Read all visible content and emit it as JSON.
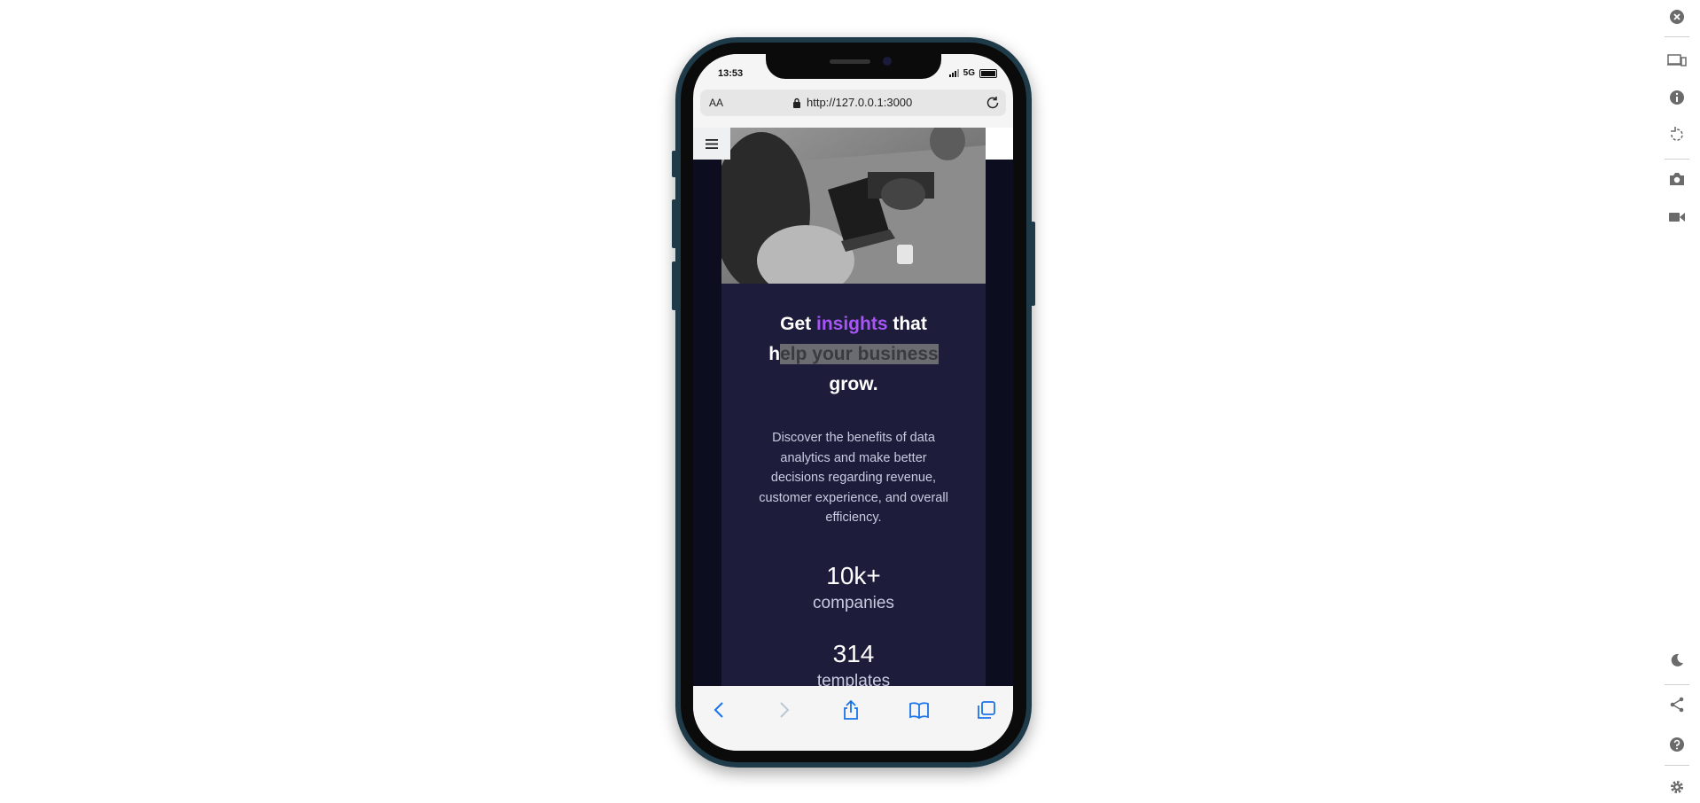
{
  "status_bar": {
    "time": "13:53",
    "network": "5G"
  },
  "browser": {
    "text_size_label": "AA",
    "url": "http://127.0.0.1:3000"
  },
  "page": {
    "menu_icon": "hamburger-menu-icon",
    "hero_image_alt": "woman-working-on-laptop",
    "headline": {
      "part1": "Get ",
      "accent": "insights",
      "part2": " that",
      "part3_plain": "h",
      "part3_highlight": "elp your business",
      "part4": "grow."
    },
    "description": "Discover the benefits of data analytics and make better decisions regarding revenue, customer experience, and overall efficiency.",
    "stats": [
      {
        "value": "10k+",
        "label": "companies"
      },
      {
        "value": "314",
        "label": "templates"
      }
    ],
    "colors": {
      "accent": "#a855f7",
      "card_bg": "#1d1c3a",
      "page_bg": "#0c0e1f"
    }
  },
  "browser_nav": {
    "icons": [
      "back-icon",
      "forward-icon",
      "share-icon",
      "bookmarks-icon",
      "tabs-icon"
    ]
  },
  "devtools_toolbar": {
    "icons": [
      "close-icon",
      "devices-icon",
      "info-icon",
      "rotate-icon",
      "screenshot-icon",
      "video-icon",
      "dark-mode-icon",
      "share-icon",
      "help-icon",
      "settings-icon"
    ]
  }
}
